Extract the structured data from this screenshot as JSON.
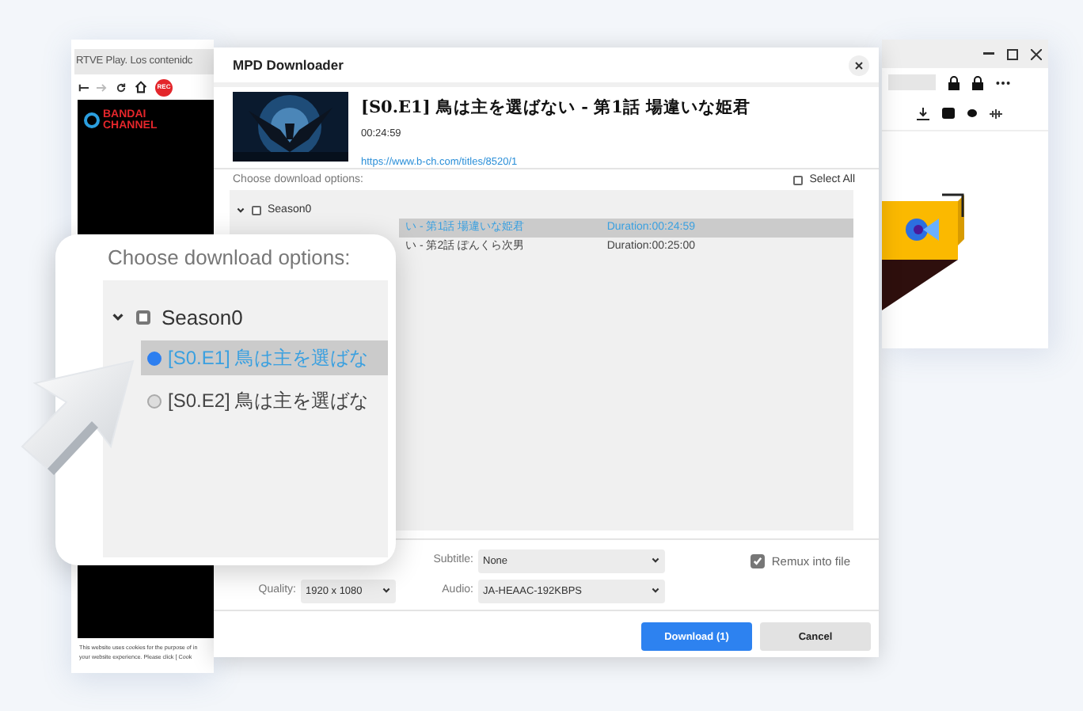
{
  "browser_left": {
    "tab_title": "RTVE Play. Los contenidc",
    "rec_badge": "REC",
    "site_logo": [
      "BANDAI",
      "CHANNEL"
    ],
    "cookie_notice": [
      "This website uses cookies for the purpose of in",
      "your website experience. Please click  [ Cook"
    ]
  },
  "dialog": {
    "title": "MPD Downloader",
    "video": {
      "title": "[S0.E1] 鳥は主を選ばない - 第1話 場違いな姫君",
      "duration": "00:24:59",
      "url": "https://www.b-ch.com/titles/8520/1"
    },
    "options_label": "Choose download options:",
    "select_all": {
      "label": "Select All",
      "checked": false
    },
    "tree": [
      {
        "label": "Season0",
        "expanded": true,
        "checked": false,
        "children": [
          {
            "label": "い - 第1話 場違いな姫君",
            "duration": "Duration:00:24:59",
            "selected": true
          },
          {
            "label": "い - 第2話 ぽんくら次男",
            "duration": "Duration:00:25:00",
            "selected": false
          }
        ]
      }
    ],
    "subtitle": {
      "label": "Subtitle:",
      "value": "None"
    },
    "quality": {
      "label": "Quality:",
      "value": "1920 x 1080"
    },
    "audio": {
      "label": "Audio:",
      "value": "JA-HEAAC-192KBPS"
    },
    "remux": {
      "label": "Remux into file",
      "checked": true
    },
    "buttons": [
      {
        "label": "Download (1)",
        "kind": "primary"
      },
      {
        "label": "Cancel",
        "kind": "secondary"
      }
    ]
  },
  "callout": {
    "title": "Choose download options:",
    "tree": [
      {
        "label": "Season0",
        "expanded": true,
        "checked": false,
        "children": [
          {
            "label": "[S0.E1] 鳥は主を選ばな",
            "selected": true
          },
          {
            "label": "[S0.E2] 鳥は主を選ばな",
            "selected": false
          }
        ]
      }
    ]
  }
}
